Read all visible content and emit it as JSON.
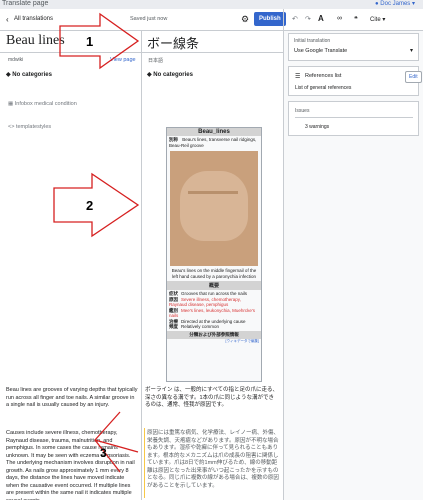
{
  "window": {
    "title": "Translate page",
    "user": "Doc James"
  },
  "toolbar": {
    "back_label": "All translations",
    "status": "Saved just now",
    "publish": "Publish",
    "style_menu": "Cite"
  },
  "source": {
    "title": "Beau lines",
    "site": "mdwiki",
    "view_page": "View page",
    "categories": "No categories",
    "template1": "Infobox medical condition",
    "template2": "templatestyles",
    "lead": "Beau lines are grooves of varying depths that typically run across all finger and toe nails.",
    "lead2": "A similar groove in a single nail is usually caused by an injury.",
    "causes": "Causes include severe illness, chemotherapy, Raynaud disease, trauma, malnutrition, and pemphigus. In some cases the cause remains unknown. It may be seen with eczema or psoriasis. The underlying mechanism involves disruption in nail growth. As nails grow approximately 1 mm every 8 days, the distance the lines have moved indicate when the causative event occurred. If multiple lines are present within the same nail it indicates multiple causal events."
  },
  "target": {
    "title": "ボー線条",
    "site": "日本語",
    "categories": "No categories",
    "infobox": {
      "title": "Beau_lines",
      "alias_key": "別称",
      "alias": "Beau's lines, transverse nail ridgings, Beau-Reil groove",
      "caption": "Beau's lines on the middle fingernail of the left hand caused by a paronychia infection",
      "section": "概要",
      "rows": [
        {
          "key": "症状",
          "val": "Grooves that run across the nails"
        },
        {
          "key": "原因",
          "val": "Severe illness, chemotherapy, Raynaud disease, pemphigus"
        },
        {
          "key": "鑑別",
          "val": "Mee's lines, leukonychia, Muehrcke's nails"
        },
        {
          "key": "治療",
          "val": "Directed at the underlying cause"
        },
        {
          "key": "頻度",
          "val": "Relatively common"
        }
      ],
      "footer": "分類および外部参照情報",
      "footer2": "[ウィキデータで編集]"
    },
    "lead": "ボーライン は、一般的にすべての指と足の爪に走る、深さの異なる溝です。1本の爪に同じような溝ができるのは、通常、怪我が原因です。",
    "causes": "原因には重篤な病気、化学療法、レイノー病、外傷、栄養失調、天疱瘡などがあります。原因が不明な場合もあります。湿疹や乾癬に伴って見られることもあります。根本的なメカニズムは爪の成長の阻害に関係しています。爪は8日で約1mm伸びるため、線の移動距離は原因となった出来事がいつ起こったかを示すものとなる。同じ爪に複数の線がある場合は、複数の原因があることを示しています。"
  },
  "right_panel": {
    "initial_label": "Initial translation",
    "initial_value": "Use Google Translate",
    "references_title": "References list",
    "references_sub": "List of general references",
    "edit": "Edit",
    "issues_label": "Issues",
    "warnings": "3 warnings"
  },
  "annotations": {
    "a1": "1",
    "a2": "2",
    "a3": "3"
  }
}
